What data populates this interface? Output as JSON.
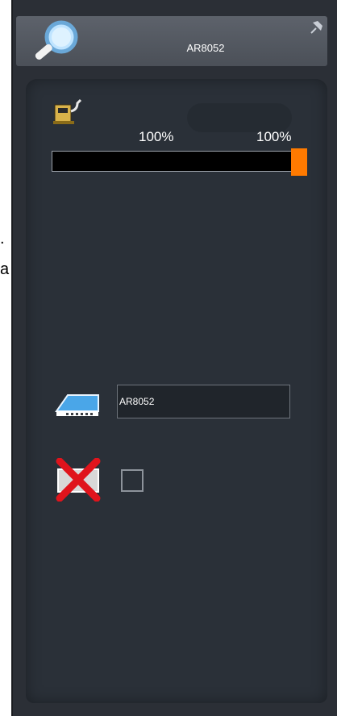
{
  "header": {
    "title": "AR8052",
    "search_icon": "magnifier-icon",
    "pin_icon": "pin-icon"
  },
  "fuel": {
    "icon": "fuel-pump-icon",
    "left_percent_label": "100%",
    "right_percent_label": "100%",
    "level_fraction": 1.0,
    "bar_color": "#ff7a00"
  },
  "flight": {
    "icon": "plane-icon",
    "value": "AR8052"
  },
  "cancel": {
    "icon": "cancel-x-icon",
    "checked": false
  },
  "background_fragments": [
    ".",
    "a"
  ]
}
